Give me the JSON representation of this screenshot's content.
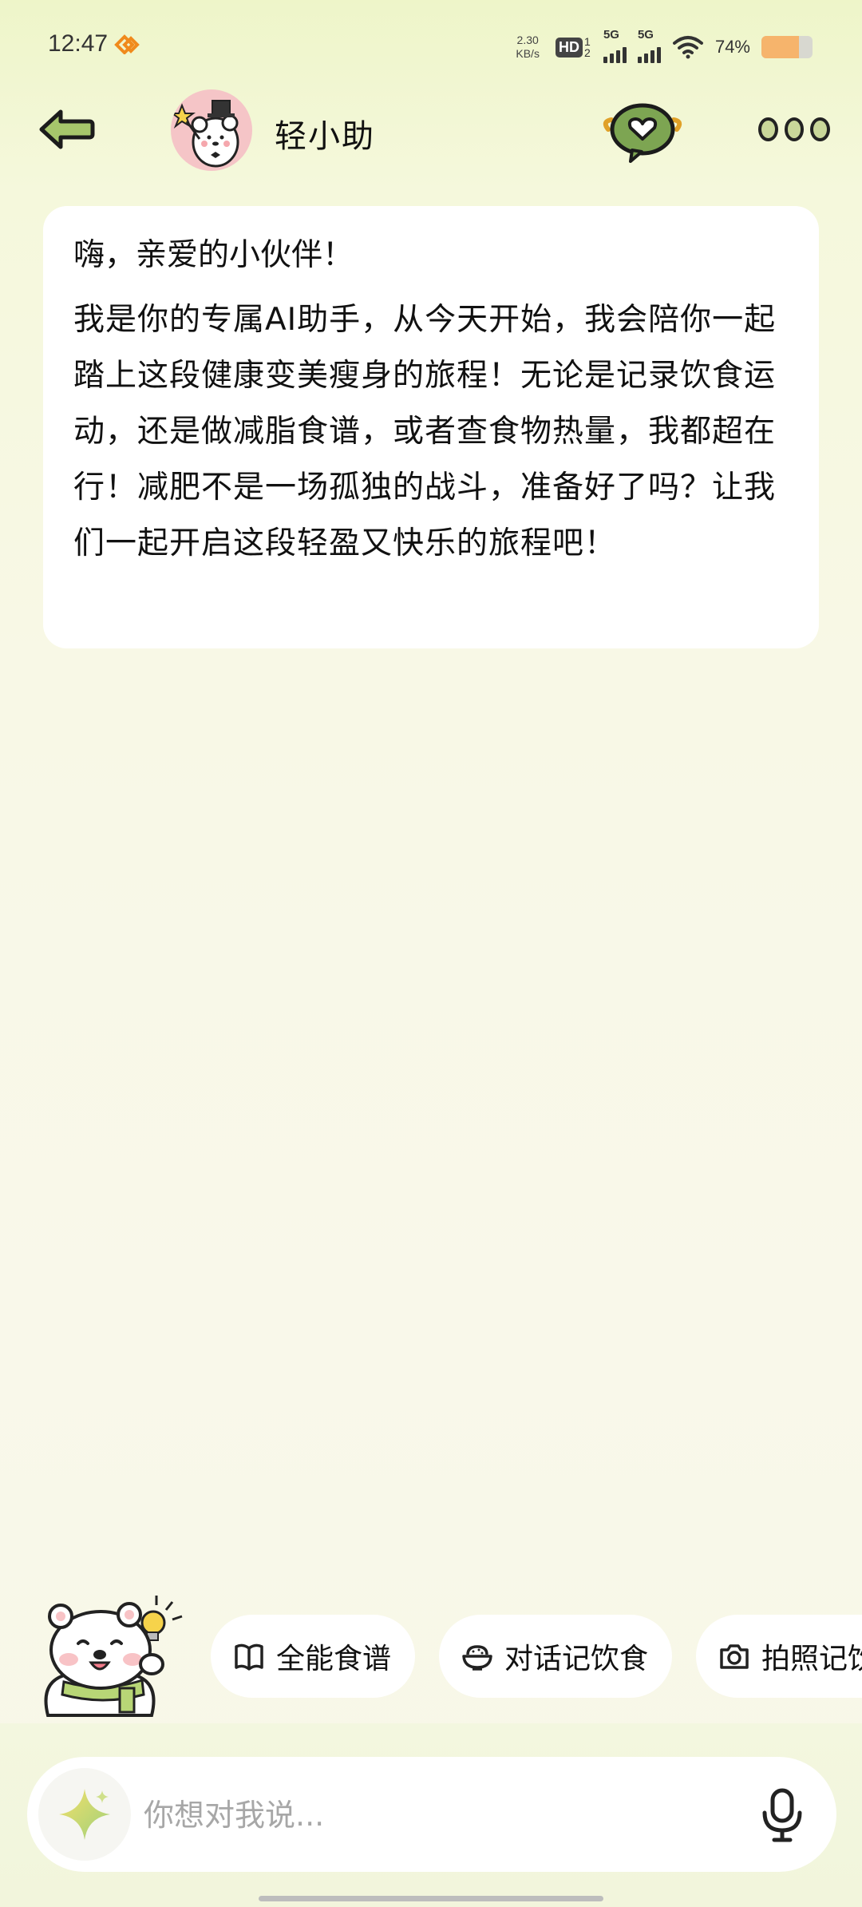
{
  "status_bar": {
    "time": "12:47",
    "net_speed_value": "2.30",
    "net_speed_unit": "KB/s",
    "hd_label": "HD",
    "hd_subscript": "1 2",
    "signal1_label": "5G",
    "signal2_label": "5G",
    "battery_percent": "74%",
    "battery_level": 0.74,
    "icons": [
      "speed-app-icon",
      "hd-voice-icon",
      "signal-icon",
      "wifi-icon",
      "battery-icon"
    ]
  },
  "header": {
    "title": "轻小助",
    "icons": [
      "back-arrow-icon",
      "assistant-avatar",
      "heart-chat-icon",
      "more-dots-icon"
    ]
  },
  "message": {
    "greeting": "嗨，亲爱的小伙伴！",
    "body": "我是你的专属AI助手，从今天开始，我会陪你一起踏上这段健康变美瘦身的旅程！无论是记录饮食运动，还是做减脂食谱，或者查食物热量，我都超在行！减肥不是一场孤独的战斗，准备好了吗？让我们一起开启这段轻盈又快乐的旅程吧！"
  },
  "quick_actions": [
    {
      "label": "全能食谱",
      "icon": "book-icon"
    },
    {
      "label": "对话记饮食",
      "icon": "rice-bowl-icon"
    },
    {
      "label": "拍照记饮食",
      "icon": "camera-icon"
    }
  ],
  "input": {
    "placeholder": "你想对我说..."
  },
  "colors": {
    "accent_green": "#a6c66b",
    "avatar_pink": "#f5c5c7",
    "battery_orange": "#f6b46c"
  }
}
